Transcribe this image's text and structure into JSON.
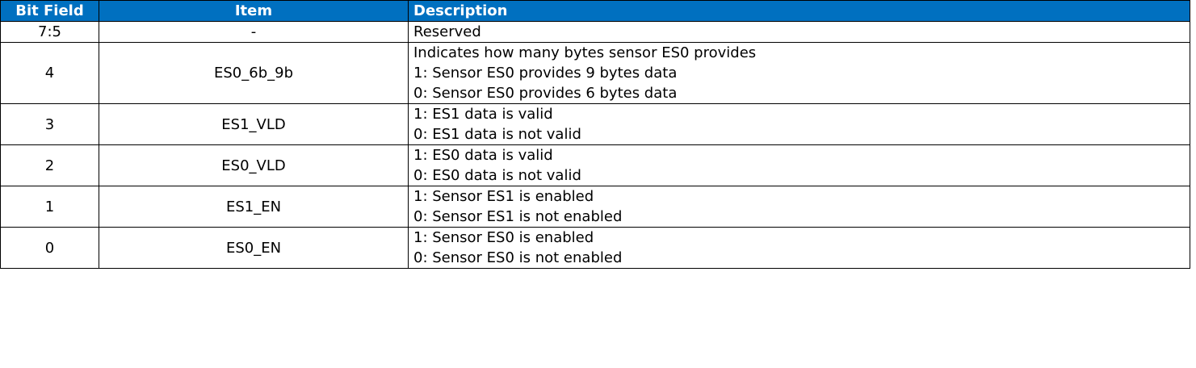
{
  "columns": {
    "bit_field": "Bit Field",
    "item": "Item",
    "description": "Description"
  },
  "header_color": "#0070c0",
  "rows": [
    {
      "bit": "7:5",
      "item": "-",
      "desc": [
        "Reserved"
      ]
    },
    {
      "bit": "4",
      "item": "ES0_6b_9b",
      "desc": [
        "Indicates how many bytes sensor ES0 provides",
        "1: Sensor ES0 provides 9 bytes data",
        "0: Sensor ES0 provides 6 bytes data"
      ]
    },
    {
      "bit": "3",
      "item": "ES1_VLD",
      "desc": [
        "1: ES1 data is valid",
        "0: ES1 data is not valid"
      ]
    },
    {
      "bit": "2",
      "item": "ES0_VLD",
      "desc": [
        "1: ES0 data is valid",
        "0: ES0 data is not valid"
      ]
    },
    {
      "bit": "1",
      "item": "ES1_EN",
      "desc": [
        "1: Sensor ES1 is enabled",
        "0: Sensor ES1 is not enabled"
      ]
    },
    {
      "bit": "0",
      "item": "ES0_EN",
      "desc": [
        "1: Sensor ES0 is enabled",
        "0: Sensor ES0 is not enabled"
      ]
    }
  ]
}
